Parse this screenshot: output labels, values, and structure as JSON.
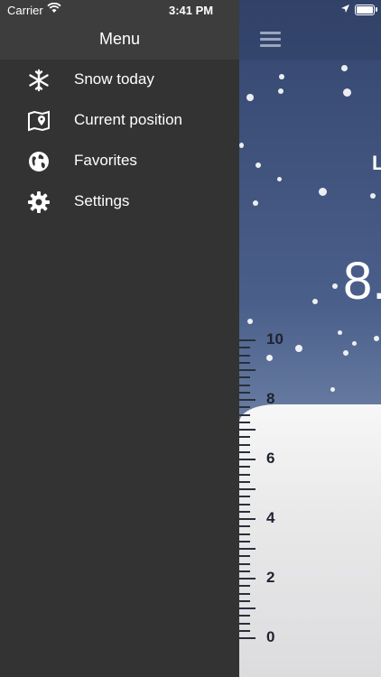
{
  "status_bar": {
    "carrier": "Carrier",
    "time": "3:41 PM"
  },
  "drawer": {
    "title": "Menu",
    "items": [
      {
        "label": "Snow today",
        "icon": "snowflake-icon"
      },
      {
        "label": "Current position",
        "icon": "map-pin-icon"
      },
      {
        "label": "Favorites",
        "icon": "globe-icon"
      },
      {
        "label": "Settings",
        "icon": "gear-icon"
      }
    ]
  },
  "app": {
    "peek_letter": "L",
    "peek_value": "8.",
    "ruler_labels": [
      "10",
      "8",
      "6",
      "4",
      "2",
      "0"
    ]
  },
  "colors": {
    "drawer_bg": "#333333",
    "drawer_header": "#3d3d3d",
    "sky_top": "#34466f"
  }
}
